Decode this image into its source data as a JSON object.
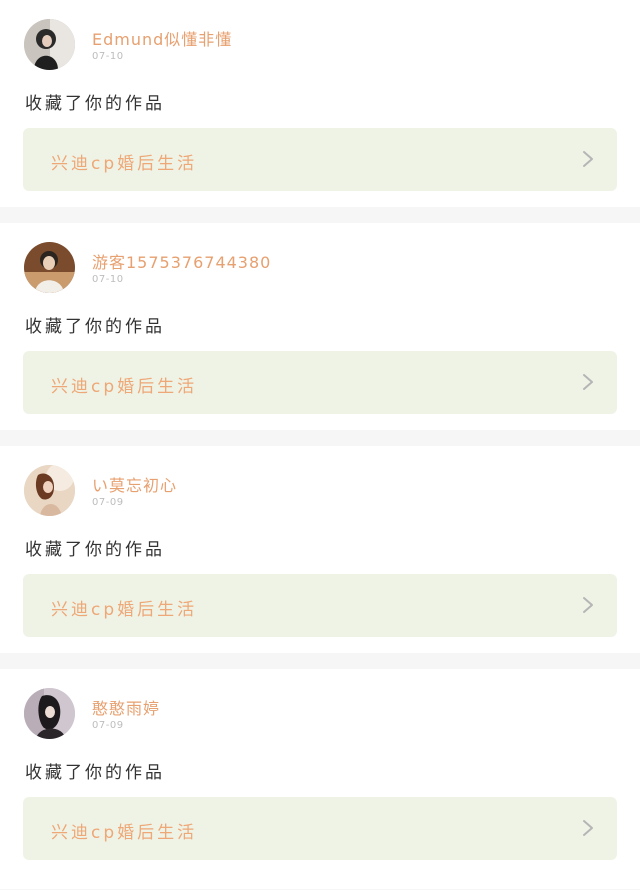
{
  "feed": {
    "items": [
      {
        "username": "Edmund似懂非懂",
        "time": "07-10",
        "action": "收藏了你的作品",
        "work_title": "兴迪cp婚后生活",
        "avatar": "user-avatar-1"
      },
      {
        "username": "游客1575376744380",
        "time": "07-10",
        "action": "收藏了你的作品",
        "work_title": "兴迪cp婚后生活",
        "avatar": "user-avatar-2"
      },
      {
        "username": "い莫忘初心",
        "time": "07-09",
        "action": "收藏了你的作品",
        "work_title": "兴迪cp婚后生活",
        "avatar": "user-avatar-3"
      },
      {
        "username": "憨憨雨婷",
        "time": "07-09",
        "action": "收藏了你的作品",
        "work_title": "兴迪cp婚后生活",
        "avatar": "user-avatar-4"
      }
    ]
  },
  "colors": {
    "accent": "#e7a06f",
    "work_bg": "#eff3e6",
    "page_bg": "#f6f6f6",
    "text": "#333333",
    "muted": "#bdbdbd"
  }
}
